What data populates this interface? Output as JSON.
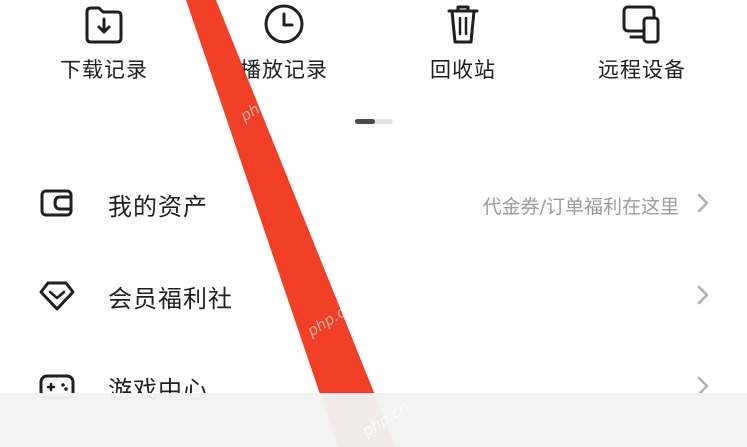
{
  "shortcuts": [
    {
      "label": "下载记录",
      "icon": "download-folder-icon"
    },
    {
      "label": "播放记录",
      "icon": "clock-icon"
    },
    {
      "label": "回收站",
      "icon": "trash-icon"
    },
    {
      "label": "远程设备",
      "icon": "devices-icon"
    }
  ],
  "pager": {
    "pages": 2,
    "active": 1
  },
  "menu": [
    {
      "title": "我的资产",
      "desc": "代金券/订单福利在这里",
      "icon": "wallet-icon"
    },
    {
      "title": "会员福利社",
      "desc": "",
      "icon": "diamond-icon"
    },
    {
      "title": "游戏中心",
      "desc": "",
      "icon": "gamepad-icon"
    }
  ],
  "watermark": "php.cn",
  "colors": {
    "stripe": "#f0361b",
    "text": "#1f1f1f",
    "secondary": "#9b9b9b",
    "chevron": "#b0b0b0",
    "pager_active": "#4a4a4a",
    "pager_track": "#e3e3e3"
  }
}
